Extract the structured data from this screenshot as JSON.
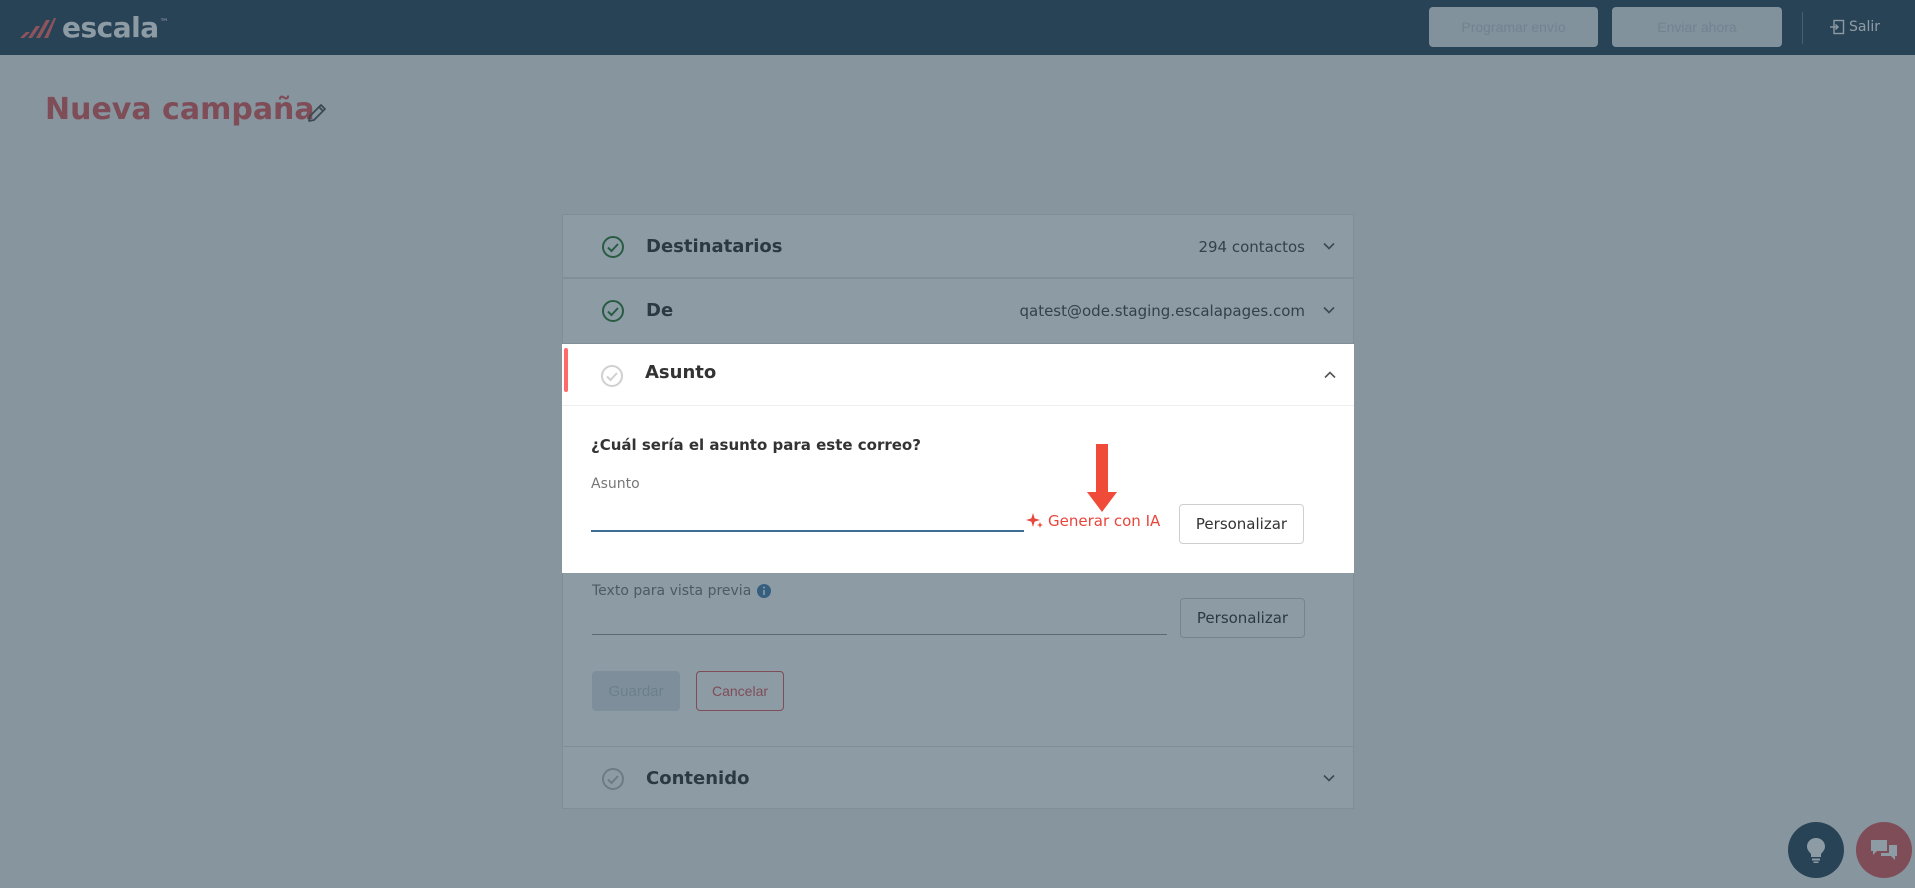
{
  "header": {
    "logo_text": "escala",
    "logo_tm": "™",
    "schedule_label": "Programar envío",
    "send_label": "Enviar ahora",
    "logout_label": "Salir"
  },
  "page": {
    "title": "Nueva campaña"
  },
  "accordion": {
    "recipients": {
      "title": "Destinatarios",
      "value": "294 contactos"
    },
    "from": {
      "title": "De",
      "value": "qatest@ode.staging.escalapages.com"
    },
    "subject": {
      "title": "Asunto",
      "question": "¿Cuál sería el asunto para este correo?",
      "field_label": "Asunto",
      "field_value": "",
      "generate_label": "Generar con IA",
      "personalize_label": "Personalizar"
    },
    "preview": {
      "label": "Texto para vista previa",
      "personalize_label": "Personalizar",
      "save_label": "Guardar",
      "cancel_label": "Cancelar"
    },
    "content": {
      "title": "Contenido"
    }
  },
  "colors": {
    "header_bg": "#2e475a",
    "accent_red": "#e05c5c",
    "success_green": "#2e7d32",
    "input_underline": "#3d6d93"
  }
}
